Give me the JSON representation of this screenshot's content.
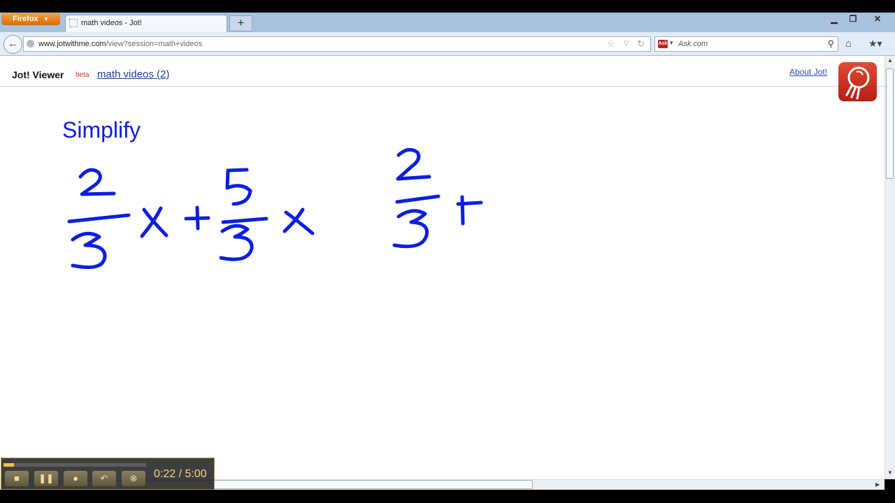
{
  "browser": {
    "menu_button": "Firefox",
    "tab_title": "math videos - Jot!",
    "new_tab_symbol": "+",
    "url_domain": "www.jotwithme.com",
    "url_path": "/view?session=math+videos",
    "search_placeholder": "Ask.com",
    "search_engine_logo": "Ask"
  },
  "page": {
    "app_title": "Jot! Viewer",
    "beta_tag": "beta",
    "session_link": "math videos (2)",
    "about_link": "About Jot!"
  },
  "whiteboard": {
    "heading": "Simplify",
    "ink_color": "#0c1fe0",
    "expression_1": "2/3 x + 5/3 x",
    "expression_2": "2/3 +"
  },
  "player": {
    "time": "0:22 / 5:00",
    "progress": 0.073,
    "buttons": [
      "stop",
      "pause",
      "microphone",
      "undo",
      "close"
    ]
  },
  "colors": {
    "accent_orange": "#e8861f",
    "link_blue": "#1d3fa5",
    "beta_red": "#d0332a",
    "logo_red": "#c8321f"
  }
}
